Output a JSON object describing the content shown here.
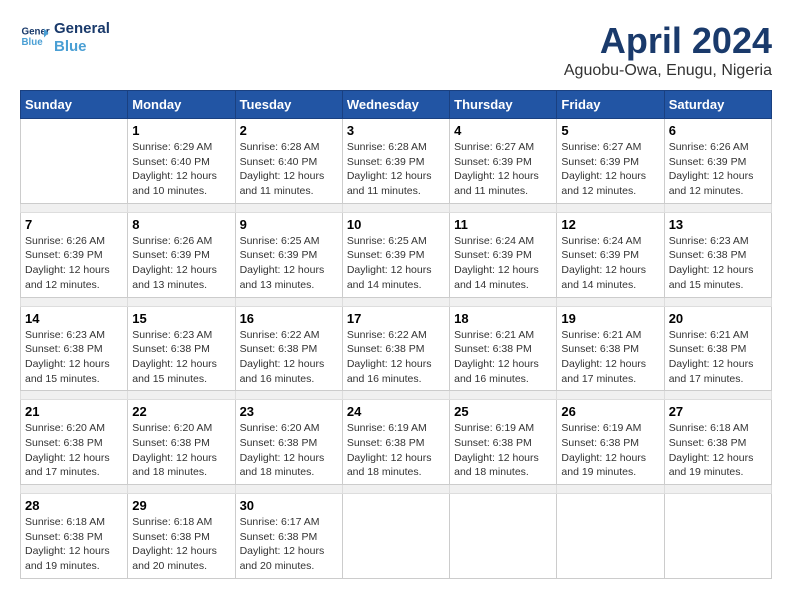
{
  "header": {
    "logo_line1": "General",
    "logo_line2": "Blue",
    "title": "April 2024",
    "subtitle": "Aguobu-Owa, Enugu, Nigeria"
  },
  "days_of_week": [
    "Sunday",
    "Monday",
    "Tuesday",
    "Wednesday",
    "Thursday",
    "Friday",
    "Saturday"
  ],
  "weeks": [
    [
      {
        "day": "",
        "info": ""
      },
      {
        "day": "1",
        "info": "Sunrise: 6:29 AM\nSunset: 6:40 PM\nDaylight: 12 hours\nand 10 minutes."
      },
      {
        "day": "2",
        "info": "Sunrise: 6:28 AM\nSunset: 6:40 PM\nDaylight: 12 hours\nand 11 minutes."
      },
      {
        "day": "3",
        "info": "Sunrise: 6:28 AM\nSunset: 6:39 PM\nDaylight: 12 hours\nand 11 minutes."
      },
      {
        "day": "4",
        "info": "Sunrise: 6:27 AM\nSunset: 6:39 PM\nDaylight: 12 hours\nand 11 minutes."
      },
      {
        "day": "5",
        "info": "Sunrise: 6:27 AM\nSunset: 6:39 PM\nDaylight: 12 hours\nand 12 minutes."
      },
      {
        "day": "6",
        "info": "Sunrise: 6:26 AM\nSunset: 6:39 PM\nDaylight: 12 hours\nand 12 minutes."
      }
    ],
    [
      {
        "day": "7",
        "info": "Sunrise: 6:26 AM\nSunset: 6:39 PM\nDaylight: 12 hours\nand 12 minutes."
      },
      {
        "day": "8",
        "info": "Sunrise: 6:26 AM\nSunset: 6:39 PM\nDaylight: 12 hours\nand 13 minutes."
      },
      {
        "day": "9",
        "info": "Sunrise: 6:25 AM\nSunset: 6:39 PM\nDaylight: 12 hours\nand 13 minutes."
      },
      {
        "day": "10",
        "info": "Sunrise: 6:25 AM\nSunset: 6:39 PM\nDaylight: 12 hours\nand 14 minutes."
      },
      {
        "day": "11",
        "info": "Sunrise: 6:24 AM\nSunset: 6:39 PM\nDaylight: 12 hours\nand 14 minutes."
      },
      {
        "day": "12",
        "info": "Sunrise: 6:24 AM\nSunset: 6:39 PM\nDaylight: 12 hours\nand 14 minutes."
      },
      {
        "day": "13",
        "info": "Sunrise: 6:23 AM\nSunset: 6:38 PM\nDaylight: 12 hours\nand 15 minutes."
      }
    ],
    [
      {
        "day": "14",
        "info": "Sunrise: 6:23 AM\nSunset: 6:38 PM\nDaylight: 12 hours\nand 15 minutes."
      },
      {
        "day": "15",
        "info": "Sunrise: 6:23 AM\nSunset: 6:38 PM\nDaylight: 12 hours\nand 15 minutes."
      },
      {
        "day": "16",
        "info": "Sunrise: 6:22 AM\nSunset: 6:38 PM\nDaylight: 12 hours\nand 16 minutes."
      },
      {
        "day": "17",
        "info": "Sunrise: 6:22 AM\nSunset: 6:38 PM\nDaylight: 12 hours\nand 16 minutes."
      },
      {
        "day": "18",
        "info": "Sunrise: 6:21 AM\nSunset: 6:38 PM\nDaylight: 12 hours\nand 16 minutes."
      },
      {
        "day": "19",
        "info": "Sunrise: 6:21 AM\nSunset: 6:38 PM\nDaylight: 12 hours\nand 17 minutes."
      },
      {
        "day": "20",
        "info": "Sunrise: 6:21 AM\nSunset: 6:38 PM\nDaylight: 12 hours\nand 17 minutes."
      }
    ],
    [
      {
        "day": "21",
        "info": "Sunrise: 6:20 AM\nSunset: 6:38 PM\nDaylight: 12 hours\nand 17 minutes."
      },
      {
        "day": "22",
        "info": "Sunrise: 6:20 AM\nSunset: 6:38 PM\nDaylight: 12 hours\nand 18 minutes."
      },
      {
        "day": "23",
        "info": "Sunrise: 6:20 AM\nSunset: 6:38 PM\nDaylight: 12 hours\nand 18 minutes."
      },
      {
        "day": "24",
        "info": "Sunrise: 6:19 AM\nSunset: 6:38 PM\nDaylight: 12 hours\nand 18 minutes."
      },
      {
        "day": "25",
        "info": "Sunrise: 6:19 AM\nSunset: 6:38 PM\nDaylight: 12 hours\nand 18 minutes."
      },
      {
        "day": "26",
        "info": "Sunrise: 6:19 AM\nSunset: 6:38 PM\nDaylight: 12 hours\nand 19 minutes."
      },
      {
        "day": "27",
        "info": "Sunrise: 6:18 AM\nSunset: 6:38 PM\nDaylight: 12 hours\nand 19 minutes."
      }
    ],
    [
      {
        "day": "28",
        "info": "Sunrise: 6:18 AM\nSunset: 6:38 PM\nDaylight: 12 hours\nand 19 minutes."
      },
      {
        "day": "29",
        "info": "Sunrise: 6:18 AM\nSunset: 6:38 PM\nDaylight: 12 hours\nand 20 minutes."
      },
      {
        "day": "30",
        "info": "Sunrise: 6:17 AM\nSunset: 6:38 PM\nDaylight: 12 hours\nand 20 minutes."
      },
      {
        "day": "",
        "info": ""
      },
      {
        "day": "",
        "info": ""
      },
      {
        "day": "",
        "info": ""
      },
      {
        "day": "",
        "info": ""
      }
    ]
  ]
}
